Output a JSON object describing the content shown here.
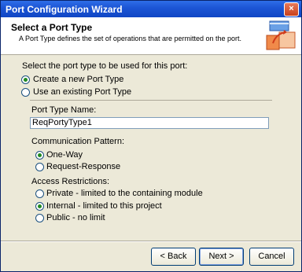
{
  "window": {
    "title": "Port Configuration Wizard",
    "close_glyph": "×"
  },
  "header": {
    "title": "Select a Port Type",
    "description": "A Port Type defines the set of operations that are permitted on the port."
  },
  "body": {
    "prompt": "Select the port type to be used for this port:",
    "port_type_options": [
      {
        "label": "Create a new Port Type",
        "selected": true
      },
      {
        "label": "Use an existing Port Type",
        "selected": false
      }
    ],
    "port_type_name_label": "Port Type Name:",
    "port_type_name_value": "ReqPortyType1",
    "communication_pattern_label": "Communication Pattern:",
    "communication_options": [
      {
        "label": "One-Way",
        "selected": true
      },
      {
        "label": "Request-Response",
        "selected": false
      }
    ],
    "access_restrictions_label": "Access Restrictions:",
    "access_options": [
      {
        "label": "Private - limited to the containing module",
        "selected": false
      },
      {
        "label": "Internal - limited to this project",
        "selected": true
      },
      {
        "label": "Public - no limit",
        "selected": false
      }
    ]
  },
  "buttons": {
    "back": "< Back",
    "next": "Next >",
    "cancel": "Cancel"
  },
  "icons": [
    "close-icon",
    "port-wizard-graphic"
  ]
}
